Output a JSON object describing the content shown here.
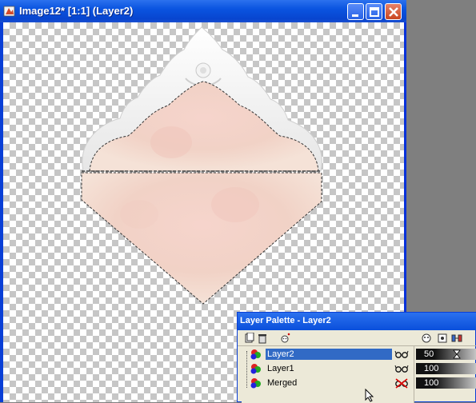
{
  "window": {
    "title": "Image12* [1:1] (Layer2)",
    "icon": "paint-shop-icon",
    "buttons": [
      "minimize-icon",
      "maximize-icon",
      "close-icon"
    ]
  },
  "palette": {
    "title": "Layer Palette - Layer2",
    "toolbar": [
      "new-layer-icon",
      "delete-layer-icon",
      "layer-properties-icon"
    ],
    "side_icons": [
      "mask-icon",
      "protect-icon",
      "link-icon"
    ],
    "layers": [
      {
        "name": "Layer2",
        "selected": true,
        "visible": true,
        "opacity": "50"
      },
      {
        "name": "Layer1",
        "selected": false,
        "visible": true,
        "opacity": "100"
      },
      {
        "name": "Merged",
        "selected": false,
        "visible": false,
        "opacity": "100"
      }
    ]
  },
  "colors": {
    "titlebar": "#0a54e0",
    "selection": "#316ac5",
    "envelope": "#f3d3c9"
  }
}
